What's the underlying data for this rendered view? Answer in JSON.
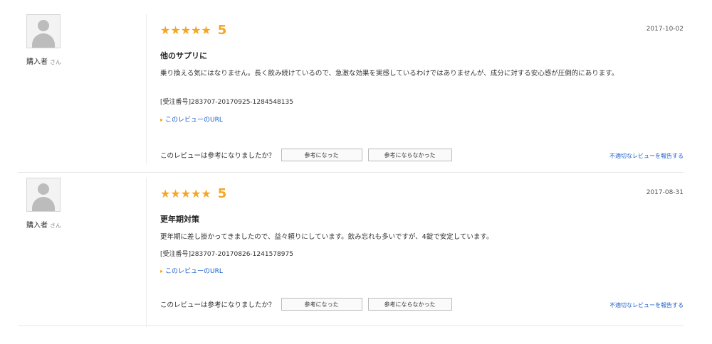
{
  "reviews": [
    {
      "reviewer": "購入者",
      "reviewer_suffix": "さん",
      "stars": "★★★★★",
      "score": "5",
      "date": "2017-10-02",
      "title": "他のサプリに",
      "body": "乗り換える気にはなりません。長く飲み続けているので、急激な効果を実感しているわけではありませんが、成分に対する安心感が圧倒的にあります。",
      "order_number": "[受注番号]283707-20170925-1284548135",
      "url_link": "このレビューのURL",
      "helpful_question": "このレビューは参考になりましたか？",
      "helpful_yes": "参考になった",
      "helpful_no": "参考にならなかった",
      "report": "不適切なレビューを報告する"
    },
    {
      "reviewer": "購入者",
      "reviewer_suffix": "さん",
      "stars": "★★★★★",
      "score": "5",
      "date": "2017-08-31",
      "title": "更年期対策",
      "body": "更年期に差し掛かってきましたので、益々頼りにしています。飲み忘れも多いですが、4錠で安定しています。",
      "order_number": "[受注番号]283707-20170826-1241578975",
      "url_link": "このレビューのURL",
      "helpful_question": "このレビューは参考になりましたか？",
      "helpful_yes": "参考になった",
      "helpful_no": "参考にならなかった",
      "report": "不適切なレビューを報告する"
    }
  ],
  "colors": {
    "star": "#f5a623",
    "link": "#1a5ccc"
  }
}
